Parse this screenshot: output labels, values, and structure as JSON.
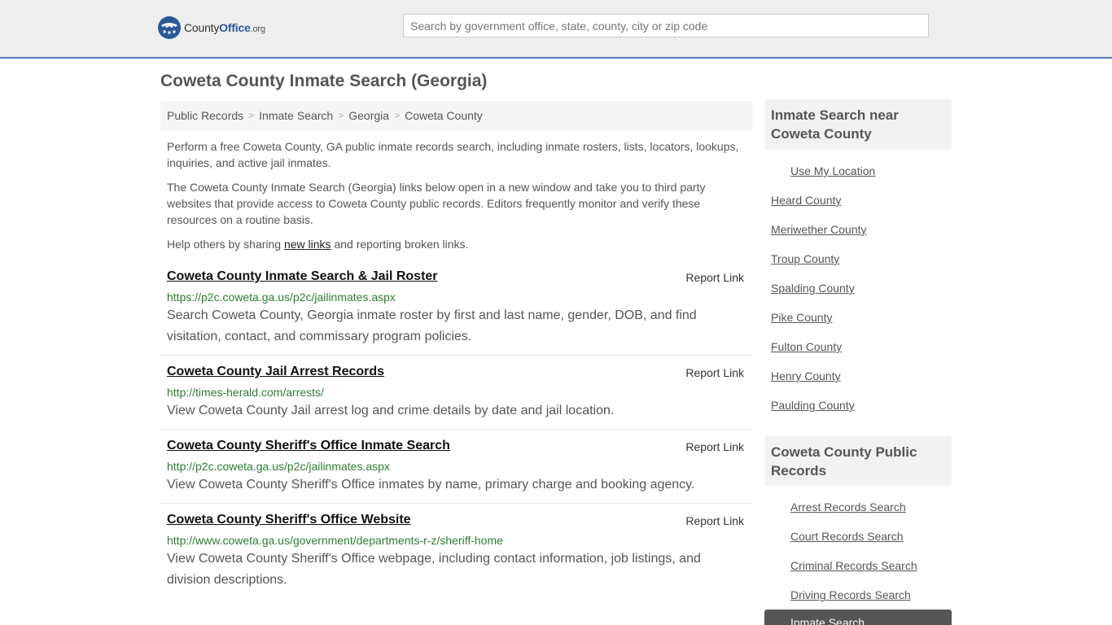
{
  "header": {
    "logo_text_prefix": "County",
    "logo_text_brand": "Office",
    "logo_text_suffix": ".org",
    "search_placeholder": "Search by government office, state, county, city or zip code"
  },
  "page": {
    "title": "Coweta County Inmate Search (Georgia)"
  },
  "breadcrumb": [
    "Public Records",
    "Inmate Search",
    "Georgia",
    "Coweta County"
  ],
  "intro": {
    "p1": "Perform a free Coweta County, GA public inmate records search, including inmate rosters, lists, locators, lookups, inquiries, and active jail inmates.",
    "p2": "The Coweta County Inmate Search (Georgia) links below open in a new window and take you to third party websites that provide access to Coweta County public records. Editors frequently monitor and verify these resources on a routine basis.",
    "p3_before": "Help others by sharing ",
    "p3_link": "new links",
    "p3_after": " and reporting broken links."
  },
  "results": [
    {
      "title": "Coweta County Inmate Search & Jail Roster",
      "report": "Report Link",
      "url": "https://p2c.coweta.ga.us/p2c/jailinmates.aspx",
      "desc": "Search Coweta County, Georgia inmate roster by first and last name, gender, DOB, and find visitation, contact, and commissary program policies."
    },
    {
      "title": "Coweta County Jail Arrest Records",
      "report": "Report Link",
      "url": "http://times-herald.com/arrests/",
      "desc": "View Coweta County Jail arrest log and crime details by date and jail location."
    },
    {
      "title": "Coweta County Sheriff's Office Inmate Search",
      "report": "Report Link",
      "url": "http://p2c.coweta.ga.us/p2c/jailinmates.aspx",
      "desc": "View Coweta County Sheriff's Office inmates by name, primary charge and booking agency."
    },
    {
      "title": "Coweta County Sheriff's Office Website",
      "report": "Report Link",
      "url": "http://www.coweta.ga.us/government/departments-r-z/sheriff-home",
      "desc": "View Coweta County Sheriff's Office webpage, including contact information, job listings, and division descriptions."
    }
  ],
  "sidebar": {
    "nearby_heading": "Inmate Search near Coweta County",
    "use_location": "Use My Location",
    "nearby": [
      "Heard County",
      "Meriwether County",
      "Troup County",
      "Spalding County",
      "Pike County",
      "Fulton County",
      "Henry County",
      "Paulding County"
    ],
    "records_heading": "Coweta County Public Records",
    "records": [
      "Arrest Records Search",
      "Court Records Search",
      "Criminal Records Search",
      "Driving Records Search"
    ],
    "active_item": "Inmate Search"
  },
  "colors": {
    "brand_blue": "#2a5a96",
    "url_green": "#2e7d32",
    "header_border": "#4f7fb8"
  }
}
